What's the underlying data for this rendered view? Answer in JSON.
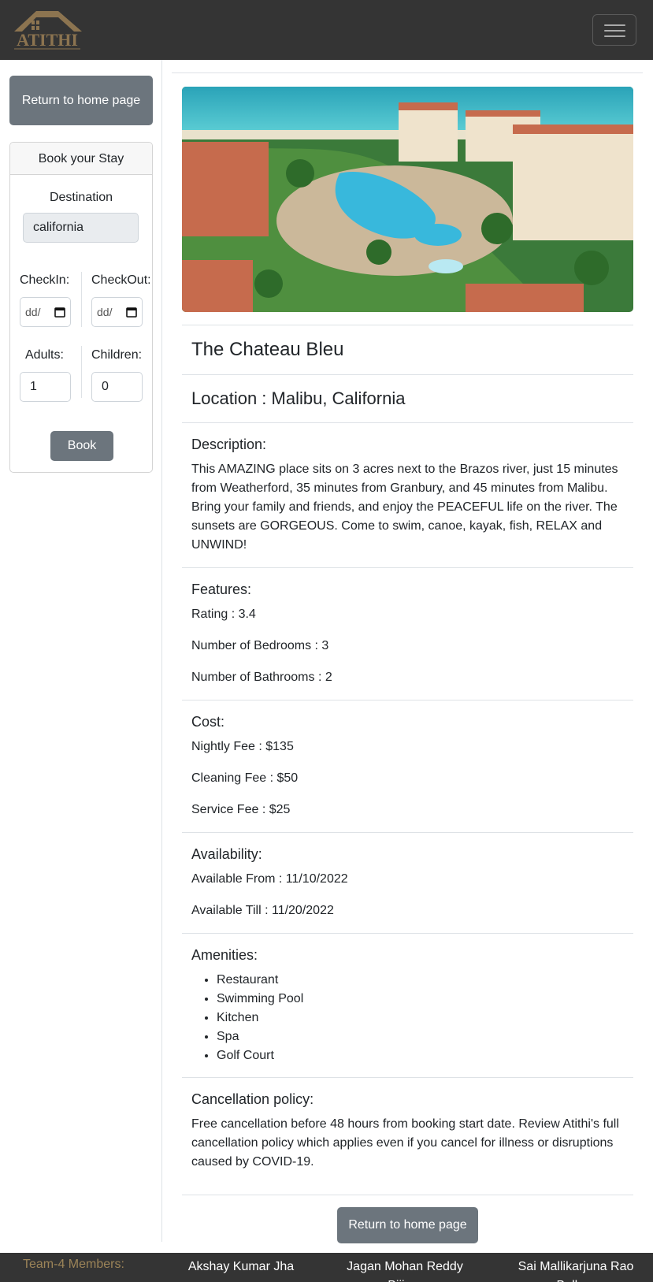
{
  "nav": {
    "logo_text": "ATITHI",
    "menu_icon": "hamburger-icon"
  },
  "sidebar": {
    "return_label": "Return to home page",
    "card_title": "Book your Stay",
    "destination_label": "Destination",
    "destination_value": "california",
    "checkin_label": "CheckIn:",
    "checkout_label": "CheckOut:",
    "date_placeholder": "dd/",
    "adults_label": "Adults:",
    "children_label": "Children:",
    "adults_value": "1",
    "children_value": "0",
    "book_label": "Book"
  },
  "listing": {
    "name": "The Chateau Bleu",
    "location": "Location : Malibu, California",
    "description_heading": "Description:",
    "description": "This AMAZING place sits on 3 acres next to the Brazos river, just 15 minutes from Weatherford, 35 minutes from Granbury, and 45 minutes from Malibu. Bring your family and friends, and enjoy the PEACEFUL life on the river. The sunsets are GORGEOUS. Come to swim, canoe, kayak, fish, RELAX and UNWIND!",
    "features_heading": "Features:",
    "rating": "Rating : 3.4",
    "bedrooms": "Number of Bedrooms : 3",
    "bathrooms": "Number of Bathrooms : 2",
    "cost_heading": "Cost:",
    "nightly_fee": "Nightly Fee : $135",
    "cleaning_fee": "Cleaning Fee : $50",
    "service_fee": "Service Fee : $25",
    "availability_heading": "Availability:",
    "available_from": "Available From : 11/10/2022",
    "available_till": "Available Till : 11/20/2022",
    "amenities_heading": "Amenities:",
    "amenities": [
      "Restaurant",
      "Swimming Pool",
      "Kitchen",
      "Spa",
      "Golf Court"
    ],
    "cancellation_heading": "Cancellation policy:",
    "cancellation": "Free cancellation before 48 hours from booking start date. Review Atithi's full cancellation policy which applies even if you cancel for illness or disruptions caused by COVID-19.",
    "return_label": "Return to home page"
  },
  "footer": {
    "team_label": "Team-4 Members:",
    "members": [
      "Akshay Kumar Jha",
      "Jagan Mohan Reddy Bijjam",
      "Sai Mallikarjuna Rao Bollam"
    ]
  },
  "colors": {
    "navbar": "#343434",
    "button": "#6c757d",
    "team_label": "#9c8458",
    "logo": "#8c7450"
  }
}
